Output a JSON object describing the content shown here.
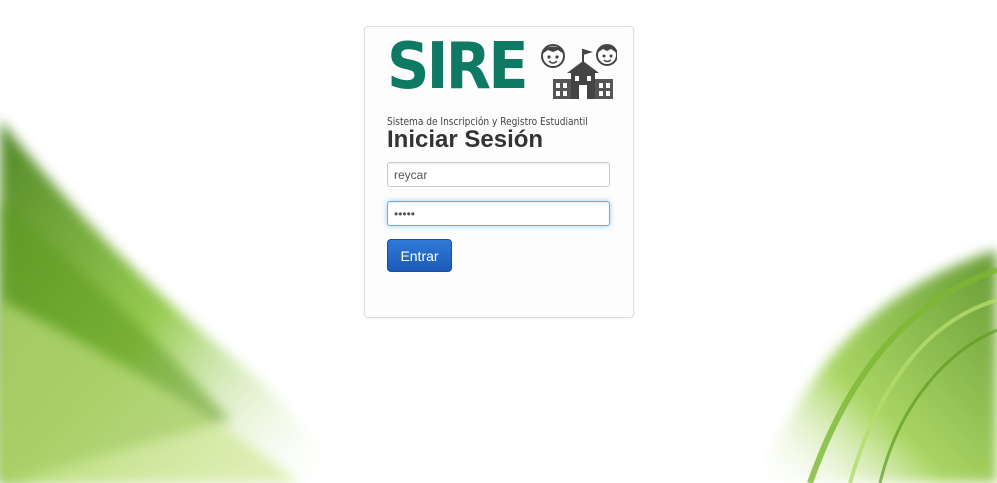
{
  "logo": {
    "brand": "SIRE",
    "subtitle": "Sistema de Inscripción y Registro Estudiantil"
  },
  "login": {
    "title": "Iniciar Sesión",
    "username_value": "reycar",
    "password_value": "reyca",
    "submit_label": "Entrar"
  },
  "colors": {
    "brand_green": "#0f7a63",
    "button_blue": "#2f79d9",
    "focus_border": "#66afe9"
  }
}
